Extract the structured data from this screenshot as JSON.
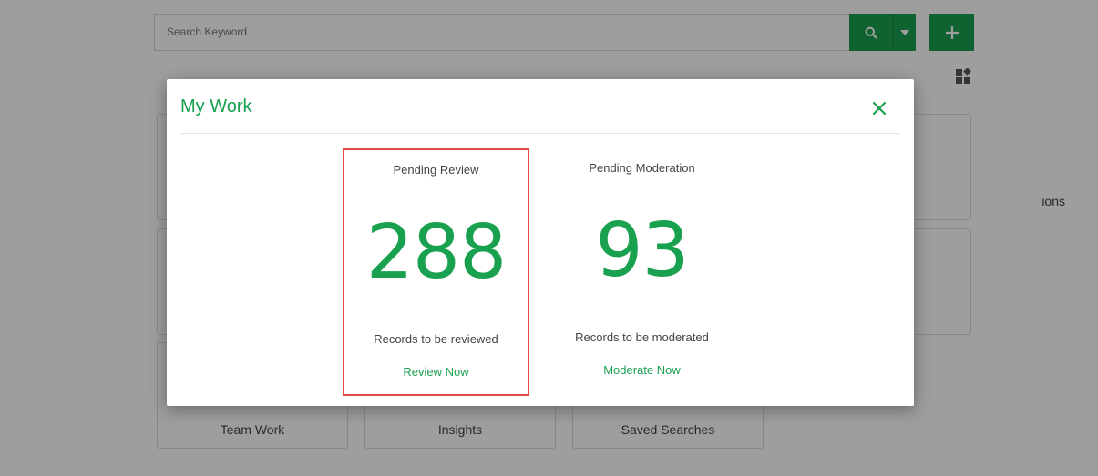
{
  "search": {
    "placeholder": "Search Keyword"
  },
  "icons": {
    "search": "search-icon",
    "dropdown": "caret-down-icon",
    "add": "plus-icon",
    "layout": "dashboard-layout-icon",
    "close": "close-icon"
  },
  "tiles": {
    "partial_label": "ions",
    "bottom": [
      {
        "label": "Team Work"
      },
      {
        "label": "Insights"
      },
      {
        "label": "Saved Searches"
      }
    ]
  },
  "modal": {
    "title": "My Work",
    "stats": [
      {
        "title": "Pending Review",
        "value": "288",
        "subtitle": "Records to be reviewed",
        "action": "Review Now",
        "highlighted": true
      },
      {
        "title": "Pending Moderation",
        "value": "93",
        "subtitle": "Records to be moderated",
        "action": "Moderate Now",
        "highlighted": false
      }
    ]
  },
  "colors": {
    "accent": "#1aa150",
    "highlight_border": "#e5474b"
  }
}
